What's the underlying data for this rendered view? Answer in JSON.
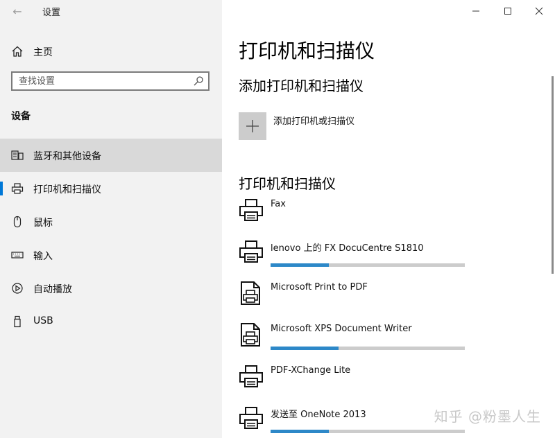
{
  "window": {
    "title": "设置"
  },
  "sidebar": {
    "home_label": "主页",
    "search_placeholder": "查找设置",
    "section_label": "设备",
    "items": [
      {
        "label": "蓝牙和其他设备",
        "icon": "keyboard-devices-icon"
      },
      {
        "label": "打印机和扫描仪",
        "icon": "printer-icon"
      },
      {
        "label": "鼠标",
        "icon": "mouse-icon"
      },
      {
        "label": "输入",
        "icon": "keyboard-icon"
      },
      {
        "label": "自动播放",
        "icon": "autoplay-icon"
      },
      {
        "label": "USB",
        "icon": "usb-icon"
      }
    ],
    "selected_index": 0,
    "indicator_index": 1
  },
  "main": {
    "page_title": "打印机和扫描仪",
    "add_section_title": "添加打印机和扫描仪",
    "add_button_label": "添加打印机或扫描仪",
    "list_section_title": "打印机和扫描仪",
    "devices": [
      {
        "name": "Fax",
        "icon": "printer-icon",
        "progress": null
      },
      {
        "name": "lenovo 上的 FX DocuCentre S1810",
        "icon": "printer-icon",
        "progress": 0.3
      },
      {
        "name": "Microsoft Print to PDF",
        "icon": "document-printer-icon",
        "progress": null
      },
      {
        "name": "Microsoft XPS Document Writer",
        "icon": "document-printer-icon",
        "progress": 0.35
      },
      {
        "name": "PDF-XChange Lite",
        "icon": "printer-icon",
        "progress": null
      },
      {
        "name": "发送至 OneNote 2013",
        "icon": "printer-icon",
        "progress": 0.3
      }
    ]
  },
  "watermark": "知乎 @粉墨人生",
  "colors": {
    "accent": "#0078d7",
    "progress": "#2d88c8",
    "sidebar_bg": "#f2f2f2",
    "selected_bg": "#d9d9d9"
  }
}
